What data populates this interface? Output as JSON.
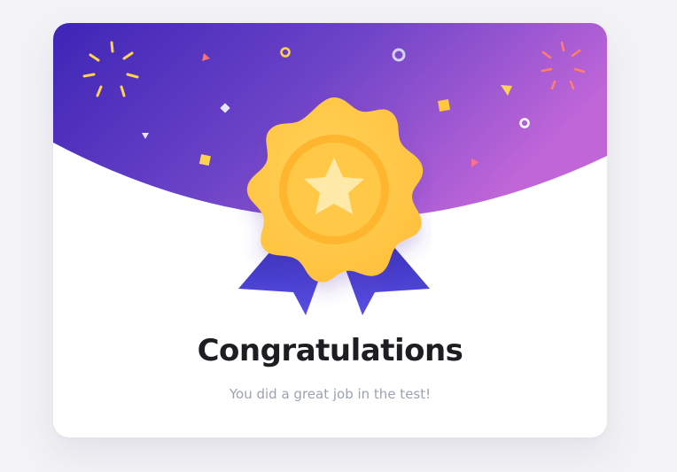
{
  "card": {
    "title": "Congratulations",
    "message": "You did a great job in the test!"
  },
  "colors": {
    "gradient_start": "#4227b8",
    "gradient_mid": "#6f45c8",
    "gradient_end": "#b963d8",
    "medal_gold": "#ffc83d",
    "medal_inner": "#ffb52e",
    "star": "#ffe9a8",
    "ribbon": "#4f46d9",
    "title_text": "#1d1d22",
    "subtitle_text": "#9aa3b5"
  },
  "icons": {
    "badge": "medal-star-icon"
  }
}
